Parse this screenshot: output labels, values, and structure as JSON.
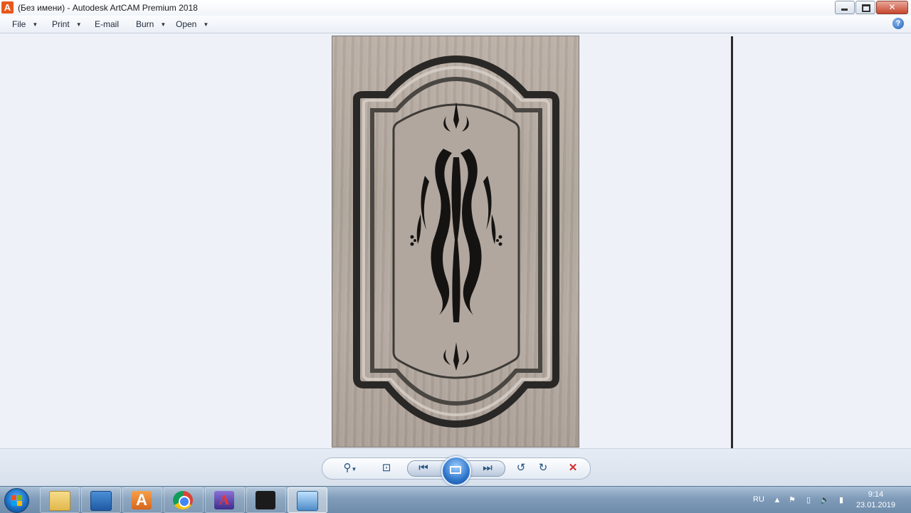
{
  "window": {
    "title": "(Без имени) - Autodesk ArtCAM Premium 2018",
    "app_icon_letter": "A",
    "buttons": [
      "minimize",
      "maximize",
      "close"
    ]
  },
  "menubar": {
    "items": [
      {
        "label": "File",
        "has_dropdown": true
      },
      {
        "label": "Print",
        "has_dropdown": true
      },
      {
        "label": "E-mail",
        "has_dropdown": false
      },
      {
        "label": "Burn",
        "has_dropdown": true
      },
      {
        "label": "Open",
        "has_dropdown": true
      }
    ],
    "help_label": "?"
  },
  "viewer": {
    "image_subject": "carved cabinet door panel"
  },
  "controls": {
    "zoom_icon": "magnifier-icon",
    "fit_icon": "fit-to-window-icon",
    "prev_icon": "previous-icon",
    "slideshow_icon": "slideshow-icon",
    "next_icon": "next-icon",
    "rotate_left_icon": "rotate-ccw-icon",
    "rotate_right_icon": "rotate-cw-icon",
    "delete_icon": "delete-icon"
  },
  "taskbar": {
    "apps": [
      "start",
      "explorer",
      "remote-desktop",
      "artcam",
      "chrome",
      "artcam-alt",
      "rhino",
      "photo-viewer"
    ],
    "active_app": "photo-viewer",
    "language": "RU",
    "time": "9:14",
    "date": "23.01.2019"
  },
  "colors": {
    "viewer_bg": "#eef2f8",
    "accent": "#2d74c9",
    "taskbar": "#7f9bb8"
  }
}
